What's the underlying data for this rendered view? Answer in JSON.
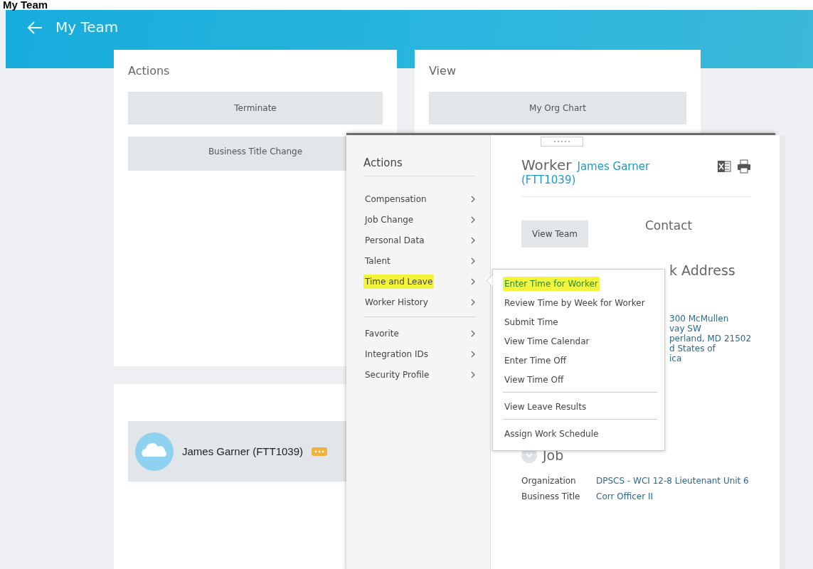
{
  "page_title": "My Team",
  "header": {
    "title": "My Team"
  },
  "actions_card": {
    "title": "Actions",
    "buttons": [
      "Terminate",
      "Business Title Change"
    ]
  },
  "view_card": {
    "title": "View",
    "buttons": [
      "My Org Chart"
    ]
  },
  "team_member": {
    "name": "James Garner (FTT1039)"
  },
  "popup": {
    "menu_title": "Actions",
    "menu_groups": [
      [
        {
          "label": "Compensation",
          "selected": false
        },
        {
          "label": "Job Change",
          "selected": false
        },
        {
          "label": "Personal Data",
          "selected": false
        },
        {
          "label": "Talent",
          "selected": false
        },
        {
          "label": "Time and Leave",
          "selected": true
        },
        {
          "label": "Worker History",
          "selected": false
        }
      ],
      [
        {
          "label": "Favorite",
          "selected": false
        },
        {
          "label": "Integration IDs",
          "selected": false
        },
        {
          "label": "Security Profile",
          "selected": false
        }
      ]
    ],
    "submenu_groups": [
      [
        {
          "label": "Enter Time for Worker",
          "selected": true
        },
        {
          "label": "Review Time by Week for Worker",
          "selected": false
        },
        {
          "label": "Submit Time",
          "selected": false
        },
        {
          "label": "View Time Calendar",
          "selected": false
        },
        {
          "label": "Enter Time Off",
          "selected": false
        },
        {
          "label": "View Time Off",
          "selected": false
        }
      ],
      [
        {
          "label": "View Leave Results",
          "selected": false
        }
      ],
      [
        {
          "label": "Assign Work Schedule",
          "selected": false
        }
      ]
    ],
    "worker": {
      "label": "Worker",
      "name": "James Garner",
      "id": "(FTT1039)",
      "view_team": "View Team",
      "contact": "Contact",
      "address_heading": "k Address",
      "address_lines": [
        "300 McMullen",
        "vay SW",
        "perland, MD 21502",
        "d States of",
        "ica"
      ],
      "job": {
        "heading": "Job",
        "fields": [
          {
            "label": "Organization",
            "value": "DPSCS - WCI 12-8 Lieutenant Unit 6"
          },
          {
            "label": "Business Title",
            "value": "Corr Officer II"
          }
        ]
      }
    }
  }
}
